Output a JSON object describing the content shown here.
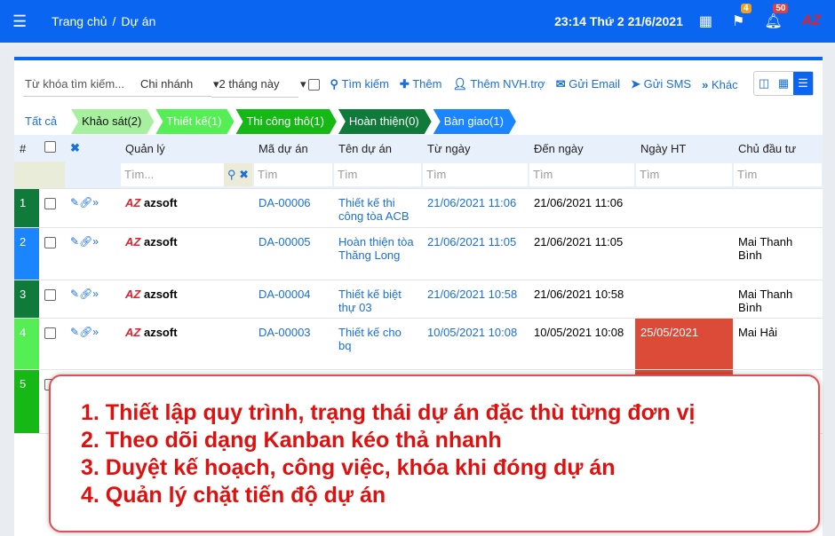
{
  "header": {
    "breadcrumb": [
      "Trang chủ",
      "/",
      "Dự án"
    ],
    "clock": "23:14  Thứ 2 21/6/2021",
    "flag_badge": "4",
    "bell_badge": "50",
    "logo": "AZ"
  },
  "toolbar": {
    "search_placeholder": "Từ khóa tìm kiếm...",
    "branch": "Chi nhánh",
    "period": "2 tháng này",
    "search": "Tìm kiếm",
    "add": "Thêm",
    "add_helper": "Thêm NVH.trợ",
    "email": "Gửi Email",
    "sms": "Gửi SMS",
    "more": "Khác"
  },
  "stages": [
    {
      "label": "Tất cả",
      "bg": "#ffffff",
      "fg": "#1a6fd8"
    },
    {
      "label": "Khảo sát(2)",
      "bg": "#a6f0a0",
      "fg": "#111"
    },
    {
      "label": "Thiết kế(1)",
      "bg": "#55ee55",
      "fg": "#fff"
    },
    {
      "label": "Thi công thô(1)",
      "bg": "#16b816",
      "fg": "#fff"
    },
    {
      "label": "Hoàn thiện(0)",
      "bg": "#0f7a3a",
      "fg": "#fff"
    },
    {
      "label": "Bàn giao(1)",
      "bg": "#1a85ff",
      "fg": "#fff"
    }
  ],
  "columns": [
    "#",
    "Quản lý",
    "Mã dự án",
    "Tên dự án",
    "Từ ngày",
    "Đến ngày",
    "Ngày HT",
    "Chủ đầu tư"
  ],
  "filter_placeholder": "Tìm",
  "filter_placeholder_first": "Tìm...",
  "rows": [
    {
      "n": "1",
      "color": "#0f7a3a",
      "manager": "azsoft",
      "code": "DA-00006",
      "name": "Thiết kế thi công tòa ACB",
      "from": "21/06/2021 11:06",
      "to": "21/06/2021 11:06",
      "done": "",
      "owner": ""
    },
    {
      "n": "2",
      "color": "#1a85ff",
      "manager": "azsoft",
      "code": "DA-00005",
      "name": "Hoàn thiện tòa Thăng Long",
      "from": "21/06/2021 11:05",
      "to": "21/06/2021 11:05",
      "done": "",
      "owner": "Mai Thanh Bình"
    },
    {
      "n": "3",
      "color": "#0f7a3a",
      "manager": "azsoft",
      "code": "DA-00004",
      "name": "Thiết kế biệt thự 03",
      "from": "21/06/2021 10:58",
      "to": "21/06/2021 10:58",
      "done": "",
      "owner": "Mai Thanh Bình"
    },
    {
      "n": "4",
      "color": "#55ee55",
      "manager": "azsoft",
      "code": "DA-00003",
      "name": "Thiết kế cho bq",
      "from": "10/05/2021 10:08",
      "to": "10/05/2021 10:08",
      "done": "25/05/2021",
      "owner": "Mai Hải"
    },
    {
      "n": "5",
      "color": "#16b816",
      "manager": "",
      "code": "",
      "name": "",
      "from": "",
      "to": "",
      "done": "",
      "owner": ""
    }
  ],
  "overlay": [
    "1. Thiết lập quy trình, trạng thái dự án đặc thù từng đơn vị",
    "2. Theo dõi dạng Kanban kéo thả nhanh",
    "3. Duyệt kế hoạch, công việc, khóa khi đóng dự án",
    "4. Quản lý chặt tiến độ dự án"
  ]
}
